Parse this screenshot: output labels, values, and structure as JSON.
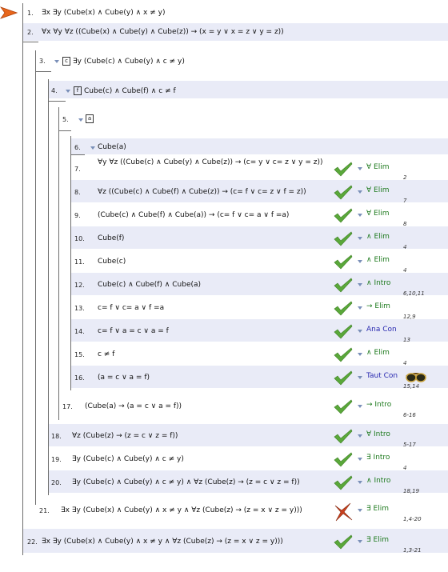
{
  "premises": [
    {
      "num": "1.",
      "text": "∃x ∃y (Cube(x) ∧ Cube(y) ∧ x ≠ y)"
    },
    {
      "num": "2.",
      "text": "∀x ∀y ∀z ((Cube(x) ∧ Cube(y) ∧ Cube(z)) → (x = y ∨ x = z ∨ y = z))"
    }
  ],
  "subproof_c": {
    "num": "3.",
    "box": "c",
    "text": "∃y (Cube(c) ∧ Cube(y) ∧ c ≠ y)"
  },
  "subproof_f": {
    "num": "4.",
    "box": "f",
    "text": "Cube(c) ∧ Cube(f) ∧ c ≠ f"
  },
  "subproof_a_box": {
    "num": "5.",
    "box": "a"
  },
  "lines": [
    {
      "num": "6.",
      "text": "Cube(a)",
      "rule": "",
      "support": "",
      "status": "none"
    },
    {
      "num": "7.",
      "text": "∀y ∀z ((Cube(c) ∧ Cube(y) ∧ Cube(z)) → (c= y ∨ c= z ∨ y = z))",
      "rule": "∀ Elim",
      "support": "2",
      "status": "ok"
    },
    {
      "num": "8.",
      "text": "∀z ((Cube(c) ∧ Cube(f) ∧ Cube(z)) → (c= f ∨ c= z ∨ f = z))",
      "rule": "∀ Elim",
      "support": "7",
      "status": "ok"
    },
    {
      "num": "9.",
      "text": "(Cube(c) ∧ Cube(f) ∧ Cube(a)) → (c= f ∨ c= a ∨ f =a)",
      "rule": "∀ Elim",
      "support": "8",
      "status": "ok"
    },
    {
      "num": "10.",
      "text": "Cube(f)",
      "rule": "∧ Elim",
      "support": "4",
      "status": "ok"
    },
    {
      "num": "11.",
      "text": "Cube(c)",
      "rule": "∧ Elim",
      "support": "4",
      "status": "ok"
    },
    {
      "num": "12.",
      "text": "Cube(c) ∧ Cube(f) ∧ Cube(a)",
      "rule": "∧ Intro",
      "support": "6,10,11",
      "status": "ok"
    },
    {
      "num": "13.",
      "text": "c= f ∨ c= a ∨ f =a",
      "rule": "→ Elim",
      "support": "12,9",
      "status": "ok"
    },
    {
      "num": "14.",
      "text": "c= f ∨ a = c ∨ a = f",
      "rule": "Ana Con",
      "support": "13",
      "status": "ok"
    },
    {
      "num": "15.",
      "text": "c ≠ f",
      "rule": "∧ Elim",
      "support": "4",
      "status": "ok"
    },
    {
      "num": "16.",
      "text": "(a = c ∨ a = f)",
      "rule": "Taut Con",
      "support": "15,14",
      "status": "ok"
    },
    {
      "num": "17.",
      "text": "(Cube(a) → (a = c ∨ a = f))",
      "rule": "→ Intro",
      "support": "6-16",
      "status": "ok"
    },
    {
      "num": "18.",
      "text": "∀z (Cube(z) → (z = c ∨ z = f))",
      "rule": "∀ Intro",
      "support": "5-17",
      "status": "ok"
    },
    {
      "num": "19.",
      "text": "∃y (Cube(c) ∧ Cube(y) ∧ c ≠ y)",
      "rule": "∃ Intro",
      "support": "4",
      "status": "ok"
    },
    {
      "num": "20.",
      "text": "∃y (Cube(c) ∧ Cube(y) ∧ c ≠ y) ∧ ∀z (Cube(z) → (z = c ∨ z = f))",
      "rule": "∧ Intro",
      "support": "18,19",
      "status": "ok"
    },
    {
      "num": "21.",
      "text": "∃x ∃y (Cube(x) ∧ Cube(y) ∧ x ≠ y ∧ ∀z (Cube(z) → (z = x ∨ z = y)))",
      "rule": "∃ Elim",
      "support": "1,4-20",
      "status": "fail"
    },
    {
      "num": "22.",
      "text": "∃x ∃y (Cube(x) ∧ Cube(y) ∧ x ≠ y ∧ ∀z (Cube(z) → (z = x ∨ z = y)))",
      "rule": "∃ Elim",
      "support": "1,3-21",
      "status": "ok"
    }
  ],
  "icons": {
    "pointer": "focus-pointer-icon",
    "check": "check-icon",
    "cross": "cross-icon",
    "goggles": "taut-con-goggles-icon",
    "expand": "expand-triangle-icon"
  },
  "colors": {
    "check_green": "#5aa83a",
    "cross_red": "#c8401e",
    "rule_green": "#1e7a1e",
    "rule_blue": "#2a2ab0",
    "alt_row": "#e9ebf7",
    "pointer_orange": "#e8661a"
  }
}
